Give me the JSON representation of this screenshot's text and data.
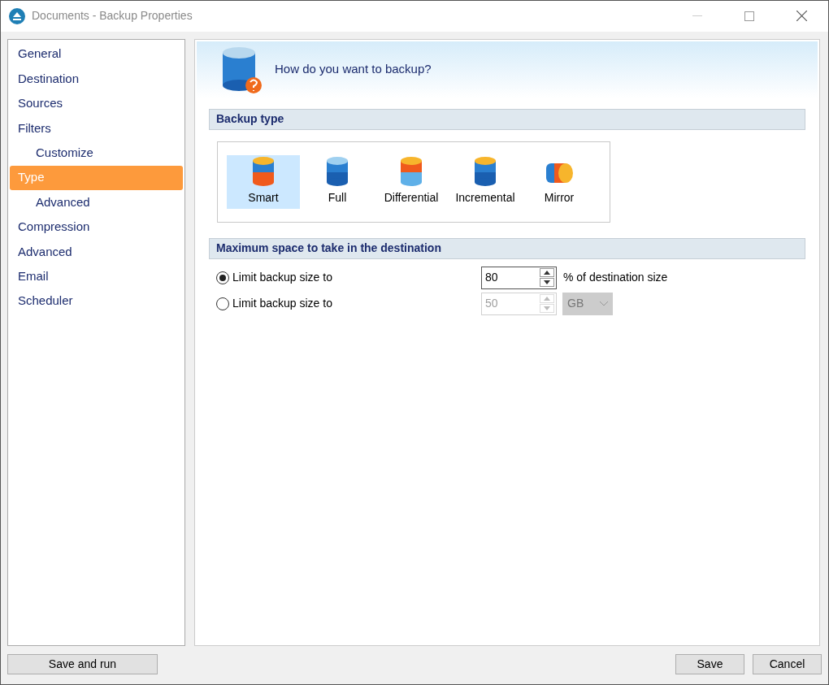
{
  "window": {
    "title": "Documents - Backup Properties"
  },
  "sidebar": {
    "items": [
      {
        "label": "General",
        "selected": false
      },
      {
        "label": "Destination",
        "selected": false
      },
      {
        "label": "Sources",
        "selected": false
      },
      {
        "label": "Filters",
        "selected": false,
        "children": [
          {
            "label": "Customize",
            "selected": false
          }
        ]
      },
      {
        "label": "Type",
        "selected": true,
        "children": [
          {
            "label": "Advanced",
            "selected": false
          }
        ]
      },
      {
        "label": "Compression",
        "selected": false
      },
      {
        "label": "Advanced",
        "selected": false
      },
      {
        "label": "Email",
        "selected": false
      },
      {
        "label": "Scheduler",
        "selected": false
      }
    ]
  },
  "header": {
    "title": "How do you want to backup?"
  },
  "backup_type": {
    "heading": "Backup type",
    "options": [
      {
        "label": "Smart",
        "kind": "smart",
        "selected": true
      },
      {
        "label": "Full",
        "kind": "full",
        "selected": false
      },
      {
        "label": "Differential",
        "kind": "differential",
        "selected": false
      },
      {
        "label": "Incremental",
        "kind": "incremental",
        "selected": false
      },
      {
        "label": "Mirror",
        "kind": "mirror",
        "selected": false
      }
    ]
  },
  "max_space": {
    "heading": "Maximum space to take in the destination",
    "options": [
      {
        "label": "Limit backup size to",
        "selected": true,
        "value": "80",
        "disabled": false,
        "unit_text": "% of destination size"
      },
      {
        "label": "Limit backup size to",
        "selected": false,
        "value": "50",
        "disabled": true,
        "unit_select": "GB"
      }
    ]
  },
  "buttons": {
    "left": "Save and run",
    "right": [
      "Save",
      "Cancel"
    ]
  }
}
